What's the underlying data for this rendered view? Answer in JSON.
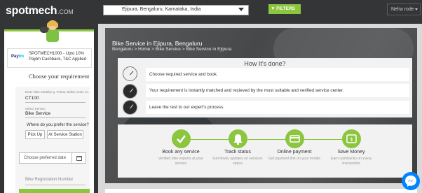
{
  "header": {
    "logo_main": "spotmech",
    "logo_suffix": ".COM",
    "location": "Ejipura, Bengaluru, Karnataka, India",
    "filters_label": "FILTERS",
    "user_name": "Neha rode"
  },
  "sidebar": {
    "promo_brand_a": "Pay",
    "promo_brand_b": "tm",
    "promo_text": "SPOTMECH1000 - Upto 10% Paytm Cashback, T&C Applied",
    "choose_title": "Choose your requirement",
    "form": {
      "vehicle_label": "Enter Bike Model(e.g. Pulsar, Bullet, Duke et...",
      "vehicle_value": "CT100",
      "service_label": "Select Service",
      "service_value": "Bike Service",
      "where_label": "Where do you prefer the service?",
      "option_pickup": "Pick Up",
      "option_station": "At Service Station",
      "date_placeholder": "Choose preferred date",
      "reg_placeholder": "Bike Registration Number"
    }
  },
  "hero": {
    "title": "Bike Service in Ejipura, Bengaluru",
    "breadcrumb": "Bengaluru > Home > Bike Service > Bike Service in Ejipura"
  },
  "how_it_works": {
    "title": "How It's done?",
    "steps": [
      "Choose required service and book.",
      "Your requirement is instantly matched and recieved by the most suitable and verified service center.",
      "Leave the rest to our expert's process."
    ]
  },
  "features": [
    {
      "title": "Book any service",
      "subtitle": "Verified bike experts at your service",
      "icon": "check-icon"
    },
    {
      "title": "Track status",
      "subtitle": "Get timely updates on services status",
      "icon": "bell-icon"
    },
    {
      "title": "Online payment",
      "subtitle": "Get payment link on your mobile",
      "icon": "card-icon"
    },
    {
      "title": "Save Money",
      "subtitle": "Earn cashbacks on every transaction",
      "icon": "wallet-icon"
    }
  ],
  "colors": {
    "accent": "#8cc63f",
    "topbar": "#333537",
    "messenger": "#0084ff"
  }
}
